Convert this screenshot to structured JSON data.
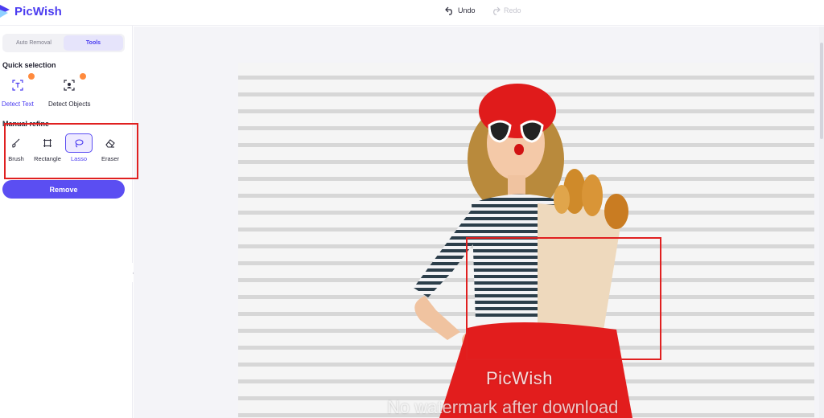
{
  "app": {
    "name": "PicWish",
    "brand_color": "#4b3cf0",
    "accent": "#5b4ef2"
  },
  "toolbar": {
    "undo_label": "Undo",
    "redo_label": "Redo"
  },
  "sidebar": {
    "tabs": [
      {
        "label": "Auto Removal",
        "active": false
      },
      {
        "label": "Tools",
        "active": true
      }
    ],
    "quick_selection": {
      "title": "Quick selection",
      "items": [
        {
          "label": "Detect Text",
          "icon": "text-select-icon",
          "active": true
        },
        {
          "label": "Detect Objects",
          "icon": "object-select-icon",
          "active": false
        }
      ]
    },
    "manual_refine": {
      "title": "Manual refine",
      "tools": [
        {
          "label": "Brush",
          "icon": "brush-icon",
          "active": false
        },
        {
          "label": "Rectangle",
          "icon": "rectangle-icon",
          "active": false
        },
        {
          "label": "Lasso",
          "icon": "lasso-icon",
          "active": true
        },
        {
          "label": "Eraser",
          "icon": "eraser-icon",
          "active": false
        }
      ]
    },
    "remove_label": "Remove"
  },
  "canvas": {
    "watermark_title": "PicWish",
    "watermark_note": "No watermark after download"
  }
}
